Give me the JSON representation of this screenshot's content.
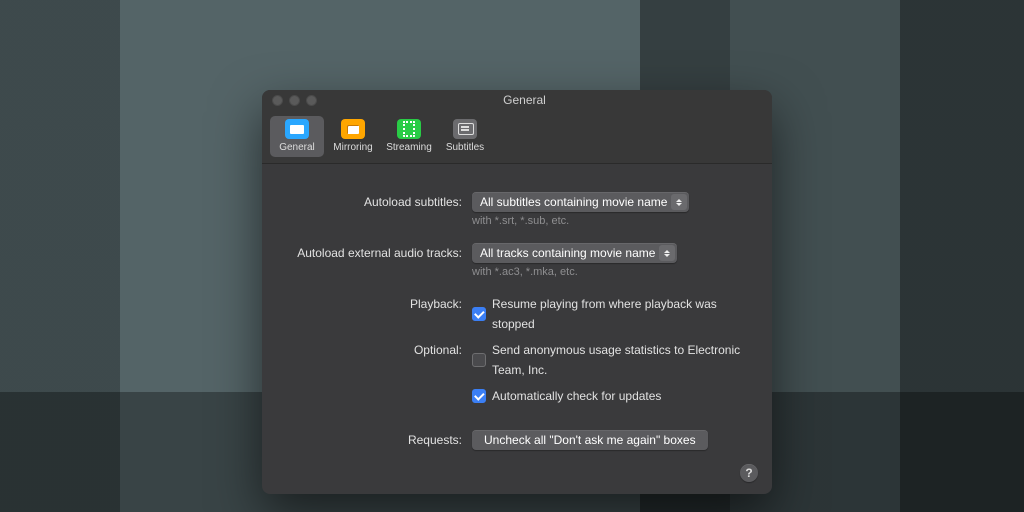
{
  "window": {
    "title": "General"
  },
  "toolbar": {
    "items": [
      {
        "label": "General",
        "icon": "general-icon",
        "selected": true
      },
      {
        "label": "Mirroring",
        "icon": "mirroring-icon",
        "selected": false
      },
      {
        "label": "Streaming",
        "icon": "streaming-icon",
        "selected": false
      },
      {
        "label": "Subtitles",
        "icon": "subtitles-icon",
        "selected": false
      }
    ]
  },
  "labels": {
    "autoload_subtitles": "Autoload subtitles:",
    "autoload_audio": "Autoload external audio tracks:",
    "playback": "Playback:",
    "optional": "Optional:",
    "requests": "Requests:"
  },
  "selects": {
    "subtitles": {
      "value": "All subtitles containing movie name",
      "hint": "with *.srt, *.sub, etc."
    },
    "audio": {
      "value": "All tracks containing movie name",
      "hint": "with *.ac3, *.mka, etc."
    }
  },
  "checks": {
    "resume": {
      "checked": true,
      "label": "Resume playing from where playback was stopped"
    },
    "stats": {
      "checked": false,
      "label": "Send anonymous usage statistics to Electronic Team, Inc."
    },
    "updates": {
      "checked": true,
      "label": "Automatically check for updates"
    }
  },
  "buttons": {
    "requests": "Uncheck all \"Don't ask me again\" boxes"
  },
  "help": "?"
}
